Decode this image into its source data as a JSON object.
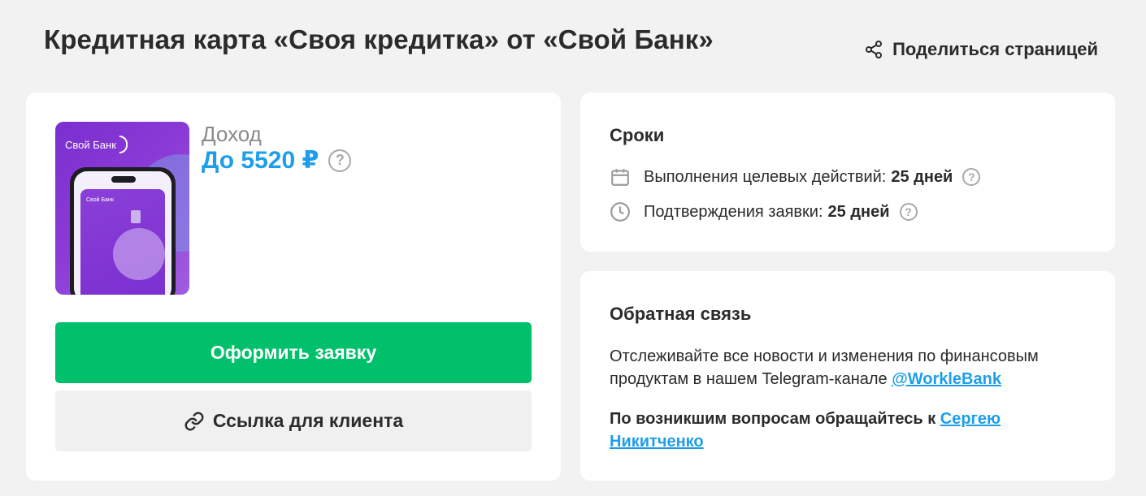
{
  "header": {
    "title": "Кредитная карта «Своя кредитка» от «Свой Банк»",
    "share_label": "Поделиться страницей"
  },
  "product": {
    "image_brand": "Свой Банк",
    "image_mini_brand": "Свой Банк",
    "income_label": "Доход",
    "income_value": "До 5520 ₽",
    "apply_button": "Оформить заявку",
    "client_link_button": "Ссылка для клиента"
  },
  "terms": {
    "title": "Сроки",
    "items": [
      {
        "label": "Выполнения целевых действий:",
        "value": "25 дней",
        "icon": "calendar-icon"
      },
      {
        "label": "Подтверждения заявки:",
        "value": "25 дней",
        "icon": "clock-icon"
      }
    ]
  },
  "feedback": {
    "title": "Обратная связь",
    "text_before": "Отслеживайте все новости и изменения по финансовым продуктам в нашем Telegram-канале ",
    "telegram_link": "@WorkleBank",
    "contact_text": "По возникшим вопросам обращайтесь к ",
    "contact_link": "Сергею Никитченко"
  },
  "colors": {
    "accent_blue": "#1e9ee8",
    "apply_green": "#00c06b",
    "background": "#f2f2f2"
  }
}
